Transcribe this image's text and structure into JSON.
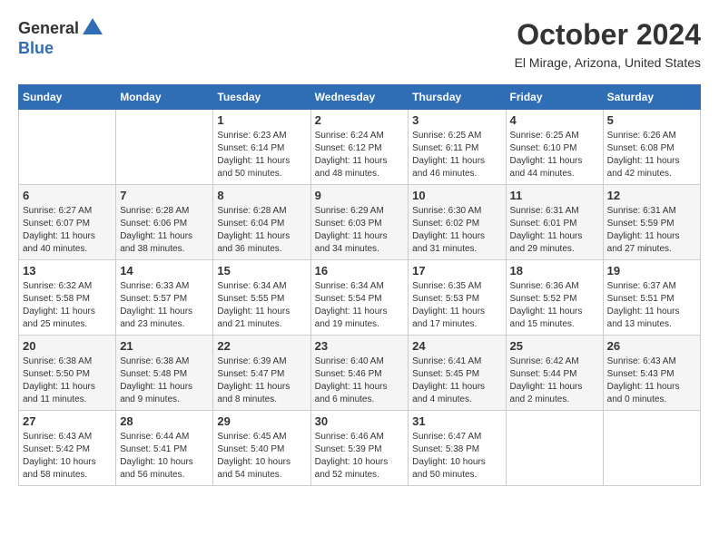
{
  "logo": {
    "general": "General",
    "blue": "Blue"
  },
  "title": "October 2024",
  "subtitle": "El Mirage, Arizona, United States",
  "headers": [
    "Sunday",
    "Monday",
    "Tuesday",
    "Wednesday",
    "Thursday",
    "Friday",
    "Saturday"
  ],
  "weeks": [
    [
      {
        "day": "",
        "info": ""
      },
      {
        "day": "",
        "info": ""
      },
      {
        "day": "1",
        "info": "Sunrise: 6:23 AM\nSunset: 6:14 PM\nDaylight: 11 hours and 50 minutes."
      },
      {
        "day": "2",
        "info": "Sunrise: 6:24 AM\nSunset: 6:12 PM\nDaylight: 11 hours and 48 minutes."
      },
      {
        "day": "3",
        "info": "Sunrise: 6:25 AM\nSunset: 6:11 PM\nDaylight: 11 hours and 46 minutes."
      },
      {
        "day": "4",
        "info": "Sunrise: 6:25 AM\nSunset: 6:10 PM\nDaylight: 11 hours and 44 minutes."
      },
      {
        "day": "5",
        "info": "Sunrise: 6:26 AM\nSunset: 6:08 PM\nDaylight: 11 hours and 42 minutes."
      }
    ],
    [
      {
        "day": "6",
        "info": "Sunrise: 6:27 AM\nSunset: 6:07 PM\nDaylight: 11 hours and 40 minutes."
      },
      {
        "day": "7",
        "info": "Sunrise: 6:28 AM\nSunset: 6:06 PM\nDaylight: 11 hours and 38 minutes."
      },
      {
        "day": "8",
        "info": "Sunrise: 6:28 AM\nSunset: 6:04 PM\nDaylight: 11 hours and 36 minutes."
      },
      {
        "day": "9",
        "info": "Sunrise: 6:29 AM\nSunset: 6:03 PM\nDaylight: 11 hours and 34 minutes."
      },
      {
        "day": "10",
        "info": "Sunrise: 6:30 AM\nSunset: 6:02 PM\nDaylight: 11 hours and 31 minutes."
      },
      {
        "day": "11",
        "info": "Sunrise: 6:31 AM\nSunset: 6:01 PM\nDaylight: 11 hours and 29 minutes."
      },
      {
        "day": "12",
        "info": "Sunrise: 6:31 AM\nSunset: 5:59 PM\nDaylight: 11 hours and 27 minutes."
      }
    ],
    [
      {
        "day": "13",
        "info": "Sunrise: 6:32 AM\nSunset: 5:58 PM\nDaylight: 11 hours and 25 minutes."
      },
      {
        "day": "14",
        "info": "Sunrise: 6:33 AM\nSunset: 5:57 PM\nDaylight: 11 hours and 23 minutes."
      },
      {
        "day": "15",
        "info": "Sunrise: 6:34 AM\nSunset: 5:55 PM\nDaylight: 11 hours and 21 minutes."
      },
      {
        "day": "16",
        "info": "Sunrise: 6:34 AM\nSunset: 5:54 PM\nDaylight: 11 hours and 19 minutes."
      },
      {
        "day": "17",
        "info": "Sunrise: 6:35 AM\nSunset: 5:53 PM\nDaylight: 11 hours and 17 minutes."
      },
      {
        "day": "18",
        "info": "Sunrise: 6:36 AM\nSunset: 5:52 PM\nDaylight: 11 hours and 15 minutes."
      },
      {
        "day": "19",
        "info": "Sunrise: 6:37 AM\nSunset: 5:51 PM\nDaylight: 11 hours and 13 minutes."
      }
    ],
    [
      {
        "day": "20",
        "info": "Sunrise: 6:38 AM\nSunset: 5:50 PM\nDaylight: 11 hours and 11 minutes."
      },
      {
        "day": "21",
        "info": "Sunrise: 6:38 AM\nSunset: 5:48 PM\nDaylight: 11 hours and 9 minutes."
      },
      {
        "day": "22",
        "info": "Sunrise: 6:39 AM\nSunset: 5:47 PM\nDaylight: 11 hours and 8 minutes."
      },
      {
        "day": "23",
        "info": "Sunrise: 6:40 AM\nSunset: 5:46 PM\nDaylight: 11 hours and 6 minutes."
      },
      {
        "day": "24",
        "info": "Sunrise: 6:41 AM\nSunset: 5:45 PM\nDaylight: 11 hours and 4 minutes."
      },
      {
        "day": "25",
        "info": "Sunrise: 6:42 AM\nSunset: 5:44 PM\nDaylight: 11 hours and 2 minutes."
      },
      {
        "day": "26",
        "info": "Sunrise: 6:43 AM\nSunset: 5:43 PM\nDaylight: 11 hours and 0 minutes."
      }
    ],
    [
      {
        "day": "27",
        "info": "Sunrise: 6:43 AM\nSunset: 5:42 PM\nDaylight: 10 hours and 58 minutes."
      },
      {
        "day": "28",
        "info": "Sunrise: 6:44 AM\nSunset: 5:41 PM\nDaylight: 10 hours and 56 minutes."
      },
      {
        "day": "29",
        "info": "Sunrise: 6:45 AM\nSunset: 5:40 PM\nDaylight: 10 hours and 54 minutes."
      },
      {
        "day": "30",
        "info": "Sunrise: 6:46 AM\nSunset: 5:39 PM\nDaylight: 10 hours and 52 minutes."
      },
      {
        "day": "31",
        "info": "Sunrise: 6:47 AM\nSunset: 5:38 PM\nDaylight: 10 hours and 50 minutes."
      },
      {
        "day": "",
        "info": ""
      },
      {
        "day": "",
        "info": ""
      }
    ]
  ]
}
